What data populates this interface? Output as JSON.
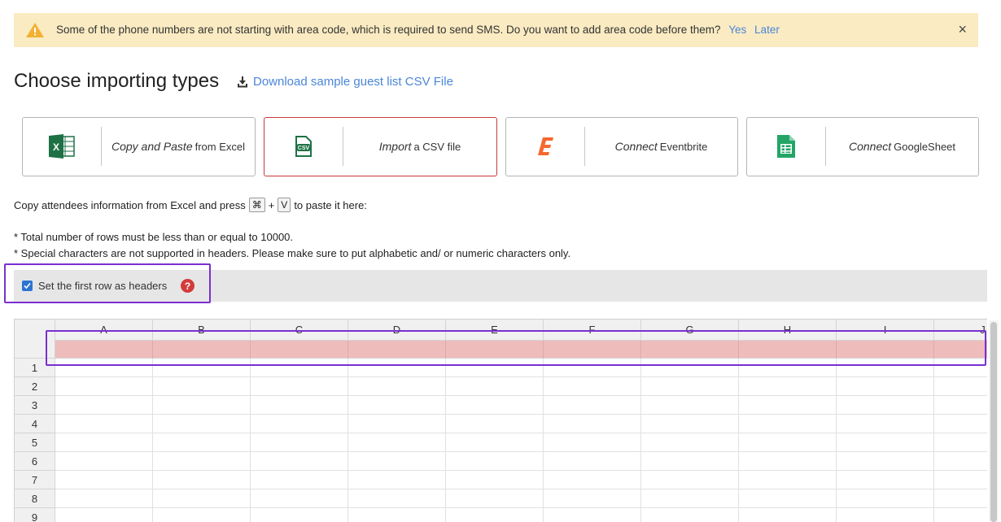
{
  "banner": {
    "message": "Some of the phone numbers are not starting with area code, which is required to send SMS. Do you want to add area code before them?",
    "yes_label": "Yes",
    "later_label": "Later",
    "close_glyph": "×",
    "icon": "warning-icon"
  },
  "page": {
    "title": "Choose importing types",
    "download_label": "Download sample guest list CSV File"
  },
  "import_types": [
    {
      "action": "Copy and Paste",
      "target": "from Excel",
      "icon": "excel-icon",
      "active": false
    },
    {
      "action": "Import",
      "target": "a CSV file",
      "icon": "csv-file-icon",
      "active": true
    },
    {
      "action": "Connect",
      "target": "Eventbrite",
      "icon": "eventbrite-icon",
      "active": false
    },
    {
      "action": "Connect",
      "target": "GoogleSheet",
      "icon": "google-sheets-icon",
      "active": false
    }
  ],
  "instructions": {
    "prefix": "Copy attendees information from Excel and press",
    "key1": "⌘",
    "plus": "+",
    "key2": "V",
    "suffix": "to paste it here:",
    "note1": "* Total number of rows must be less than or equal to 10000.",
    "note2": "* Special characters are not supported in headers. Please make sure to put alphabetic and/ or numeric characters only."
  },
  "header_option": {
    "label": "Set the first row as headers",
    "checked": true,
    "help_glyph": "?"
  },
  "spreadsheet": {
    "columns": [
      "A",
      "B",
      "C",
      "D",
      "E",
      "F",
      "G",
      "H",
      "I",
      "J"
    ],
    "rows": [
      "1",
      "2",
      "3",
      "4",
      "5",
      "6",
      "7",
      "8",
      "9"
    ]
  },
  "colors": {
    "accent_link": "#4a86d8",
    "active_card_border": "#c7393a",
    "banner_bg": "#faebc2",
    "header_row_fill": "#efbcbc",
    "highlight_outline": "#7a2fd0",
    "checkbox": "#2c73d2",
    "help_icon": "#d33b3b"
  }
}
